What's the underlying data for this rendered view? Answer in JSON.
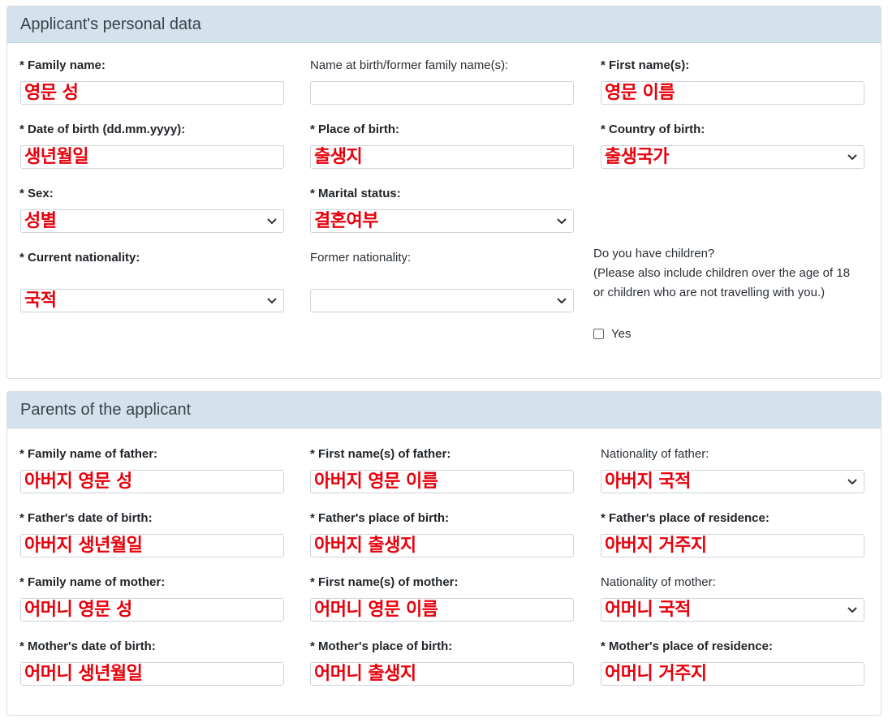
{
  "section_personal": {
    "title": "Applicant's personal data",
    "family_name": {
      "label": "* Family name:",
      "value": "영문 성"
    },
    "name_at_birth": {
      "label": "Name at birth/former family name(s):",
      "value": ""
    },
    "first_name": {
      "label": "* First name(s):",
      "value": "영문 이름"
    },
    "date_of_birth": {
      "label": "* Date of birth (dd.mm.yyyy):",
      "value": "생년월일"
    },
    "place_of_birth": {
      "label": "* Place of birth:",
      "value": "출생지"
    },
    "country_of_birth": {
      "label": "* Country of birth:",
      "value": "출생국가"
    },
    "sex": {
      "label": "* Sex:",
      "value": "성별"
    },
    "marital_status": {
      "label": "* Marital status:",
      "value": "결혼여부"
    },
    "current_nationality": {
      "label": "* Current nationality:",
      "value": "국적"
    },
    "former_nationality": {
      "label": "Former nationality:",
      "value": ""
    },
    "children": {
      "question": "Do you have children?",
      "note": "(Please also include children over the age of 18 or children who are not travelling with you.)",
      "checkbox_label": "Yes",
      "checked": false
    }
  },
  "section_parents": {
    "title": "Parents of the applicant",
    "father_family_name": {
      "label": "* Family name of father:",
      "value": "아버지 영문 성"
    },
    "father_first_name": {
      "label": "* First name(s) of father:",
      "value": "아버지 영문 이름"
    },
    "father_nationality": {
      "label": "Nationality of father:",
      "value": "아버지 국적"
    },
    "father_dob": {
      "label": "* Father's date of birth:",
      "value": "아버지 생년월일"
    },
    "father_pob": {
      "label": "* Father's place of birth:",
      "value": "아버지 출생지"
    },
    "father_residence": {
      "label": "* Father's place of residence:",
      "value": "아버지 거주지"
    },
    "mother_family_name": {
      "label": "* Family name of mother:",
      "value": "어머니 영문 성"
    },
    "mother_first_name": {
      "label": "* First name(s) of mother:",
      "value": "어머니 영문 이름"
    },
    "mother_nationality": {
      "label": "Nationality of mother:",
      "value": "어머니 국적"
    },
    "mother_dob": {
      "label": "* Mother's date of birth:",
      "value": "어머니 생년월일"
    },
    "mother_pob": {
      "label": "* Mother's place of birth:",
      "value": "어머니 출생지"
    },
    "mother_residence": {
      "label": "* Mother's place of residence:",
      "value": "어머니 거주지"
    }
  },
  "icons": {
    "select_arrow": "chevron-down-icon",
    "checkbox": "checkbox-icon"
  },
  "colors": {
    "header_bg": "#d4e2ec",
    "value_text": "#e8000b",
    "border": "#ced4da"
  }
}
